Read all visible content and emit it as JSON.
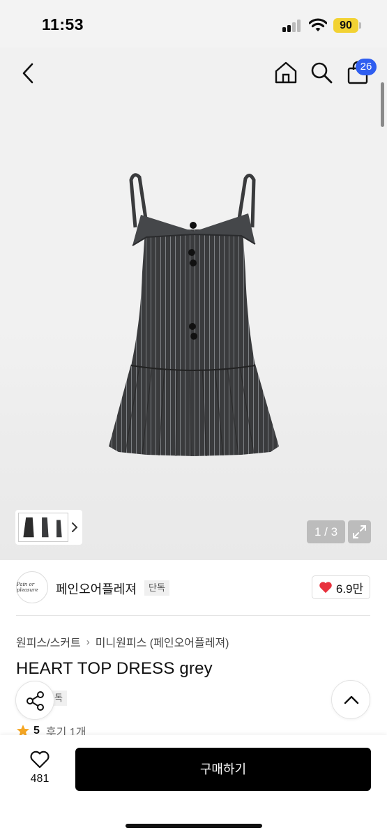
{
  "status": {
    "time": "11:53",
    "battery": "90"
  },
  "nav": {
    "cart_count": "26"
  },
  "gallery": {
    "page_counter": "1 / 3"
  },
  "shop": {
    "name": "페인오어플레져",
    "tag": "단독",
    "logo_text": "Pain or pleasure",
    "likes": "6.9만"
  },
  "product": {
    "breadcrumb": [
      "원피스/스커트",
      "미니원피스 (페인오어플레져)"
    ],
    "title": "HEART TOP DRESS grey",
    "tag": "단독",
    "rating": "5",
    "reviews": "후기 1개"
  },
  "bottom": {
    "wish_count": "481",
    "buy_label": "구매하기"
  },
  "colors": {
    "accent": "#2f5ef0",
    "battery": "#f2d233",
    "heart": "#e8313d",
    "star": "#f5a623"
  }
}
